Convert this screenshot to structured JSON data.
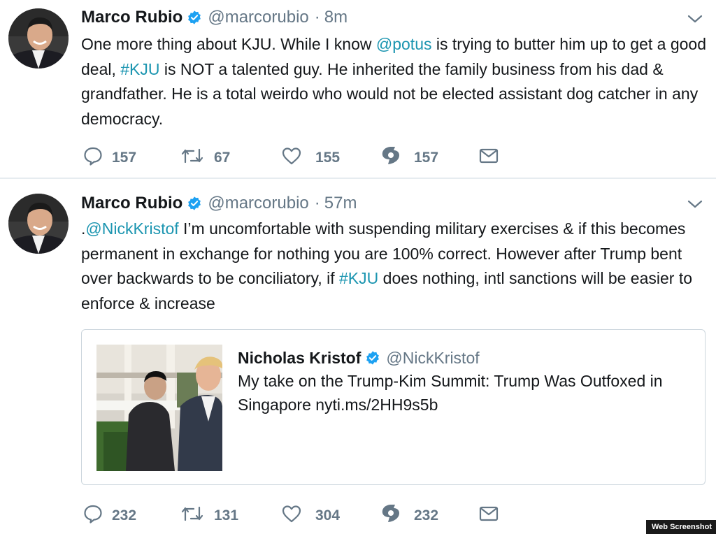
{
  "tweets": [
    {
      "author": {
        "name": "Marco Rubio",
        "handle": "@marcorubio",
        "time": "8m"
      },
      "text": {
        "p1": "One more thing about KJU. While I know ",
        "mention": "@potus",
        "p2": " is trying to butter him up to get a good deal, ",
        "hashtag": "#KJU",
        "p3": " is NOT a talented guy. He inherited the family business from his dad & grandfather. He is a total weirdo who would not be elected assistant dog catcher in any democracy."
      },
      "stats": {
        "replies": "157",
        "retweets": "67",
        "likes": "155",
        "shares": "157"
      }
    },
    {
      "author": {
        "name": "Marco Rubio",
        "handle": "@marcorubio",
        "time": "57m"
      },
      "text": {
        "p0": ".",
        "mention": "@NickKristof",
        "p1": " I’m uncomfortable with suspending military exercises & if this becomes permanent in exchange for nothing you are 100% correct. However after Trump bent over backwards to be conciliatory, if ",
        "hashtag": "#KJU",
        "p2": " does nothing, intl sanctions will be easier to enforce & increase"
      },
      "quote": {
        "name": "Nicholas Kristof",
        "handle": "@NickKristof",
        "text": "My take on the Trump-Kim Summit: Trump Was Outfoxed in Singapore nyti.ms/2HH9s5b"
      },
      "stats": {
        "replies": "232",
        "retweets": "131",
        "likes": "304",
        "shares": "232"
      }
    }
  ],
  "watermark": "Web Screenshot",
  "icons": {
    "verified": "verified-badge-icon",
    "caret": "chevron-down-icon",
    "reply": "reply-icon",
    "retweet": "retweet-icon",
    "like": "heart-icon",
    "share": "share-count-icon",
    "message": "envelope-icon"
  },
  "colors": {
    "link": "#1b95b0",
    "verified": "#1da1f2",
    "muted": "#657786",
    "text": "#14171a",
    "border": "#ccd6dd"
  }
}
